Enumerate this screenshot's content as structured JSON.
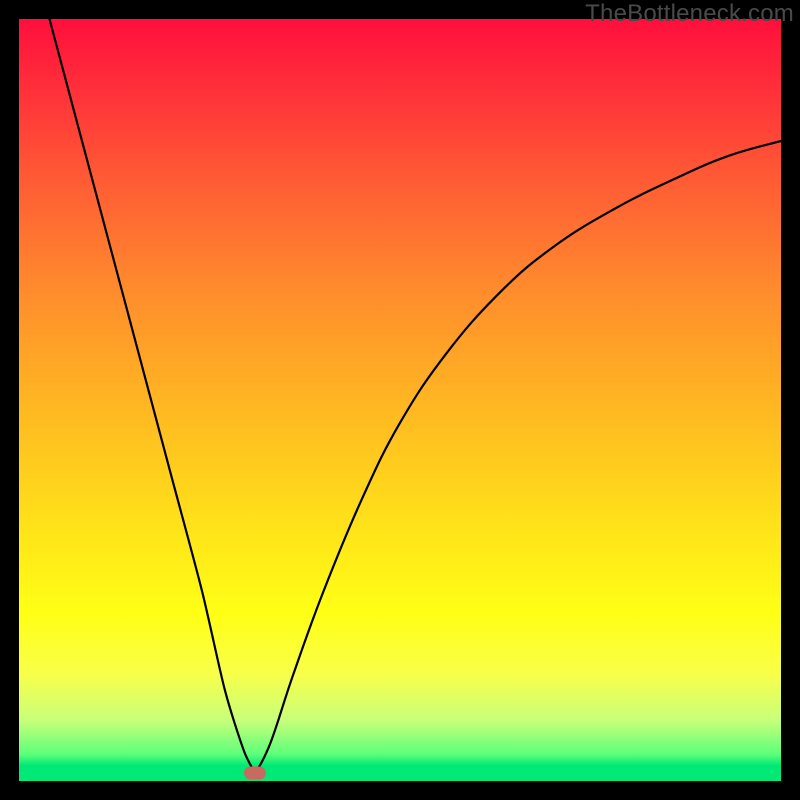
{
  "watermark": "TheBottleneck.com",
  "chart_data": {
    "type": "line",
    "title": "",
    "xlabel": "",
    "ylabel": "",
    "xlim": [
      0,
      100
    ],
    "ylim": [
      0,
      100
    ],
    "grid": false,
    "series": [
      {
        "name": "left-branch",
        "x": [
          4,
          8,
          12,
          16,
          20,
          24,
          27,
          29.5,
          31
        ],
        "values": [
          100,
          85,
          70,
          55,
          40,
          25,
          12,
          4,
          1
        ]
      },
      {
        "name": "right-branch",
        "x": [
          31,
          33,
          36,
          40,
          45,
          50,
          56,
          63,
          70,
          78,
          86,
          93,
          100
        ],
        "values": [
          1,
          5,
          14,
          25,
          37,
          47,
          56,
          64,
          70,
          75,
          79,
          82,
          84
        ]
      }
    ],
    "marker": {
      "x": 31,
      "y": 1,
      "color": "#c76a60"
    },
    "gradient_stops": [
      {
        "pos": 0,
        "color": "#ff0f3c"
      },
      {
        "pos": 50,
        "color": "#ffb522"
      },
      {
        "pos": 80,
        "color": "#ffff15"
      },
      {
        "pos": 100,
        "color": "#00e876"
      }
    ]
  }
}
